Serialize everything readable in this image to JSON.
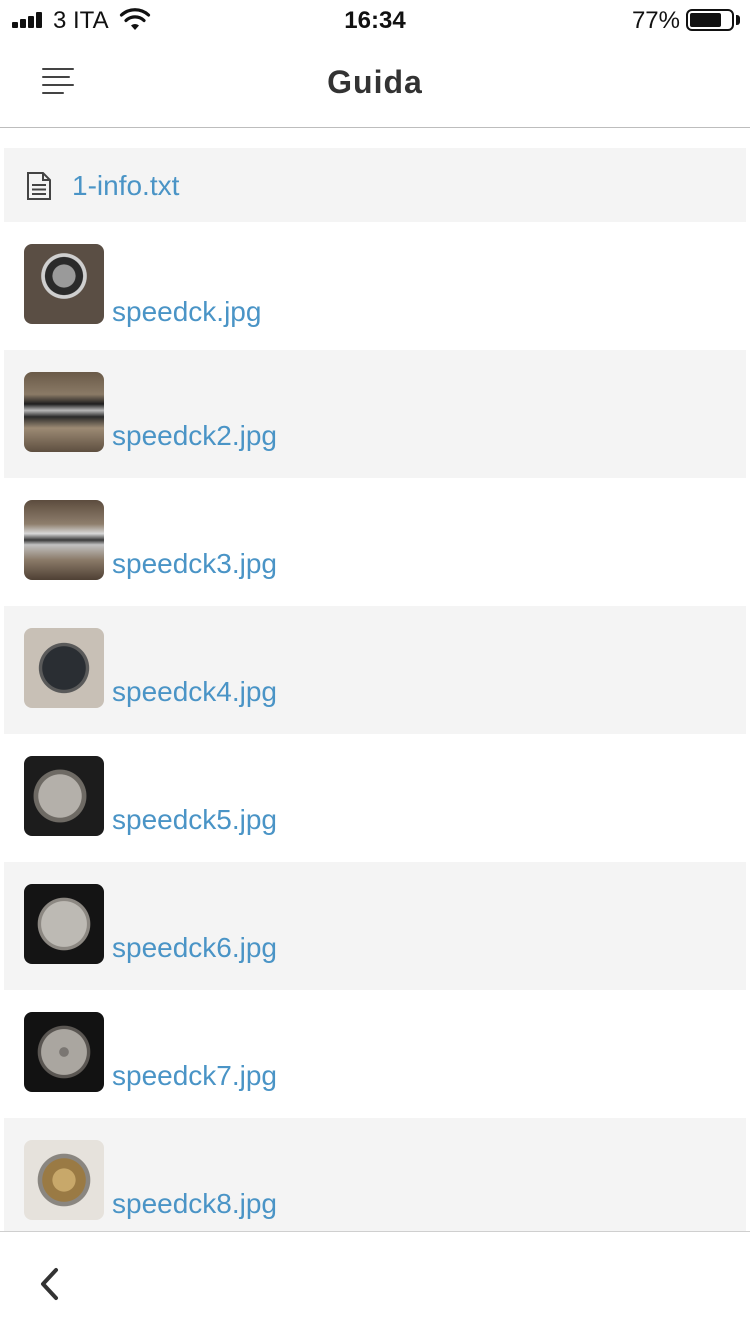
{
  "status_bar": {
    "carrier": "3 ITA",
    "time": "16:34",
    "battery_percent": "77%",
    "battery_level": 0.77
  },
  "header": {
    "title": "Guida",
    "menu_icon": "menu-lines-icon"
  },
  "files": [
    {
      "name": "1-info.txt",
      "type": "text",
      "icon": "document-icon"
    },
    {
      "name": "speedck.jpg",
      "type": "image"
    },
    {
      "name": "speedck2.jpg",
      "type": "image"
    },
    {
      "name": "speedck3.jpg",
      "type": "image"
    },
    {
      "name": "speedck4.jpg",
      "type": "image"
    },
    {
      "name": "speedck5.jpg",
      "type": "image"
    },
    {
      "name": "speedck6.jpg",
      "type": "image"
    },
    {
      "name": "speedck7.jpg",
      "type": "image"
    },
    {
      "name": "speedck8.jpg",
      "type": "image"
    }
  ],
  "bottom_bar": {
    "back_icon": "chevron-left-icon"
  },
  "colors": {
    "link": "#4a94c6",
    "row_alt": "#f4f4f4",
    "divider": "#bdbdbd"
  }
}
